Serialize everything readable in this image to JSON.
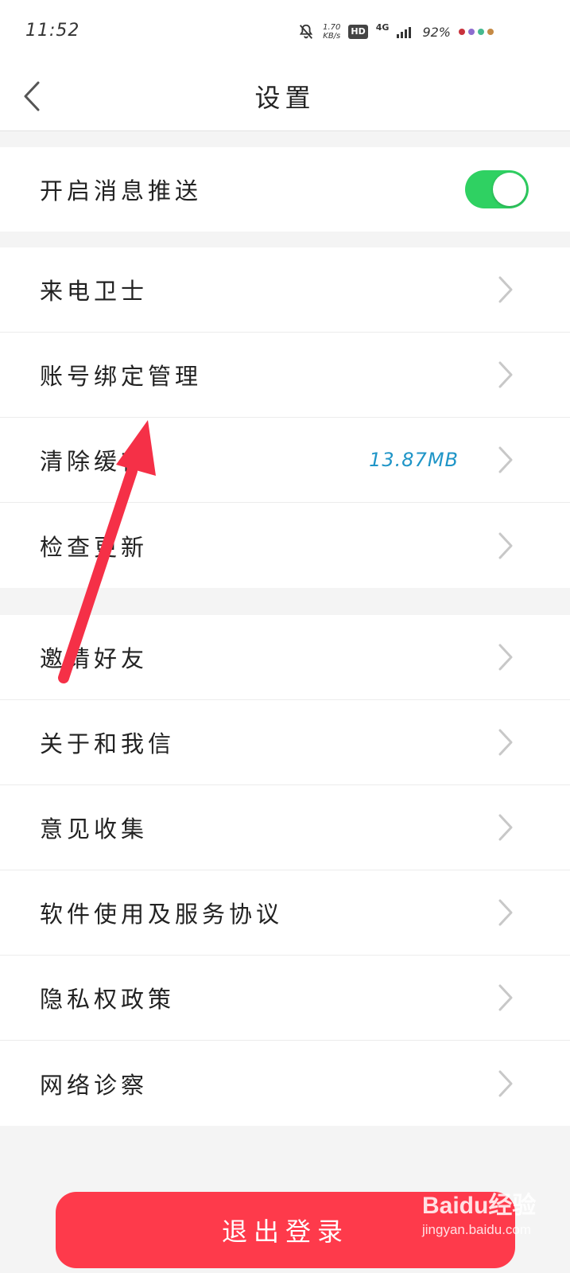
{
  "status_bar": {
    "time": "11:52",
    "speed_value": "1.70",
    "speed_unit": "KB/s",
    "hd_label": "HD",
    "network_label": "4G",
    "battery": "92%",
    "dot_colors": [
      "#c8323c",
      "#8d6ccf",
      "#45b98f",
      "#c58a45"
    ]
  },
  "nav": {
    "title": "设置"
  },
  "settings": {
    "push": {
      "label": "开启消息推送",
      "enabled": true
    },
    "group2": [
      {
        "label": "来电卫士",
        "value": ""
      },
      {
        "label": "账号绑定管理",
        "value": ""
      },
      {
        "label": "清除缓存",
        "value": "13.87MB"
      },
      {
        "label": "检查更新",
        "value": ""
      }
    ],
    "group3": [
      {
        "label": "邀请好友"
      },
      {
        "label": "关于和我信"
      },
      {
        "label": "意见收集"
      },
      {
        "label": "软件使用及服务协议"
      },
      {
        "label": "隐私权政策"
      },
      {
        "label": "网络诊察"
      }
    ]
  },
  "logout": {
    "label": "退出登录",
    "color": "#fe3a4b"
  },
  "overlay": {
    "arrow_color": "#f53047"
  },
  "watermark": {
    "brand": "Baidu经验",
    "domain": "jingyan.baidu.com"
  }
}
